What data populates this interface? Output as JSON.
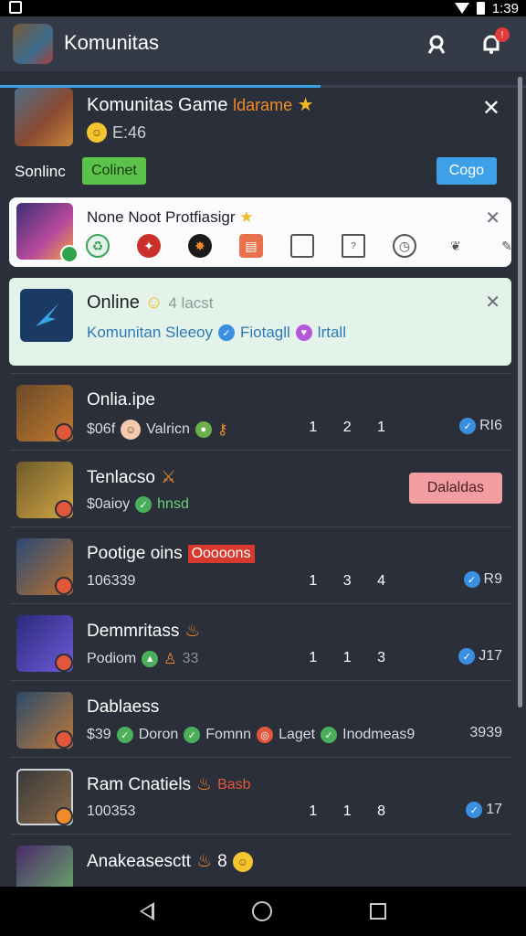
{
  "status_bar": {
    "time": "1:39"
  },
  "app_bar": {
    "title": "Komunitas",
    "notification_count": "!",
    "progress": 0.61
  },
  "hero": {
    "title": "Komunitas Game",
    "tag": "ldarame",
    "subtitle": "E:46",
    "status_label": "Sonlinc",
    "status_pill": "Colinet",
    "go_button": "Cogo"
  },
  "card_white": {
    "title": "None Noot Protfiasigr"
  },
  "card_green": {
    "title": "Online",
    "title_muted": "4 lacst",
    "sub_1": "Komunitan Sleeoy",
    "sub_2": "Fiotagll",
    "sub_3": "lrtall"
  },
  "rows": [
    {
      "title": "Onlia.ipe",
      "sub_a": "$06f",
      "sub_b": "Valricn",
      "stats": "1 2 1",
      "count": "RI6",
      "colors": [
        "#6b4a2a",
        "#c07a2e"
      ]
    },
    {
      "title": "Tenlacso",
      "sub_a": "$0aioy",
      "sub_b": "hnsd",
      "button": "Dalaldas",
      "colors": [
        "#6d5a2a",
        "#d2a544"
      ]
    },
    {
      "title": "Pootige oins",
      "tag": "Ooooons",
      "sub_a": "106339",
      "stats": "1 3 4",
      "count": "R9",
      "colors": [
        "#2a4a78",
        "#b8702e"
      ]
    },
    {
      "title": "Demmritass",
      "sub_a": "Podiom",
      "sub_b": "33",
      "stats": "1 1 3",
      "count": "J17",
      "colors": [
        "#2b2a7a",
        "#6e5ad8"
      ]
    },
    {
      "title": "Dablaess",
      "sub_a": "$39",
      "sub_b": "Doron",
      "sub_c": "Fomnn",
      "sub_d": "Laget",
      "sub_e": "Inodmeas9",
      "count": "3939",
      "colors": [
        "#2a4a6a",
        "#c07a3a"
      ]
    },
    {
      "title": "Ram Cnatiels",
      "tag": "Basb",
      "sub_a": "100353",
      "stats": "1 1 8",
      "count": "17",
      "colors": [
        "#3a3a3a",
        "#8a6a4a"
      ]
    },
    {
      "title": "Anakeasesctt",
      "title_suffix": "8",
      "colors": [
        "#4a2a6a",
        "#6ab06a"
      ]
    }
  ]
}
